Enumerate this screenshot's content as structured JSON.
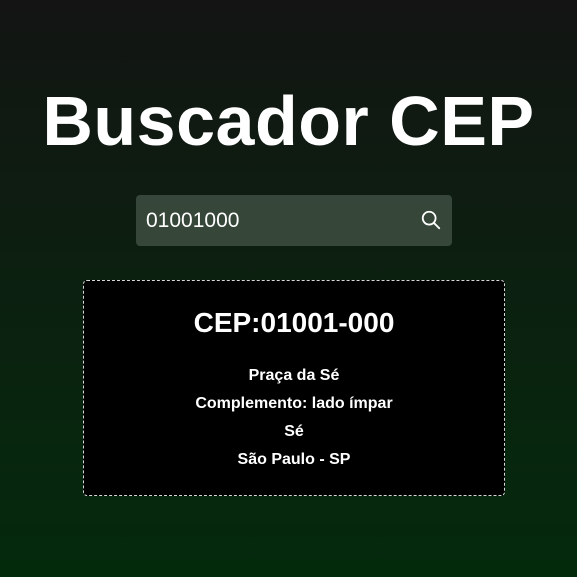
{
  "header": {
    "title": "Buscador CEP"
  },
  "search": {
    "value": "01001000",
    "icon": "search-icon"
  },
  "result": {
    "cep_label": "CEP:",
    "cep_value": "01001-000",
    "logradouro": "Praça da Sé",
    "complemento": "Complemento: lado ímpar",
    "bairro": "Sé",
    "cidade_uf": "São Paulo - SP"
  },
  "colors": {
    "background_top": "#131413",
    "background_bottom": "#042a0c",
    "card_background": "#000000",
    "text": "#ffffff"
  }
}
